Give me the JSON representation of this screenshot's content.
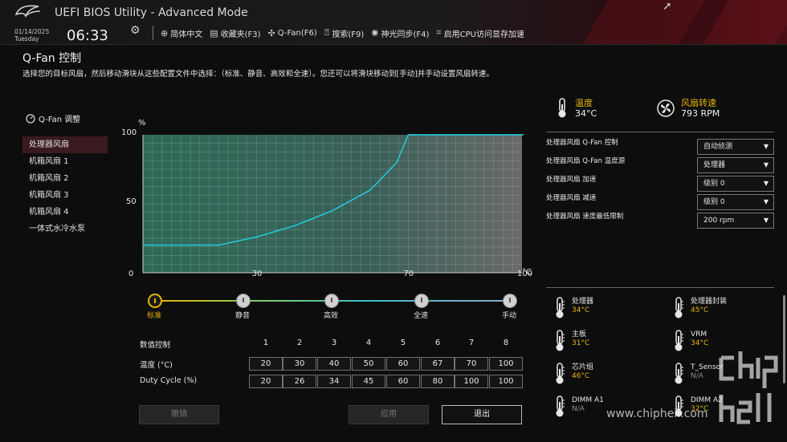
{
  "header": {
    "app_title": "UEFI BIOS Utility - Advanced Mode",
    "date": "01/14/2025",
    "weekday": "Tuesday",
    "time": "06:33",
    "menu": [
      {
        "icon": "globe-icon",
        "label": "简体中文"
      },
      {
        "icon": "bookmark-icon",
        "label": "收藏夹(F3)"
      },
      {
        "icon": "fan-icon",
        "label": "Q-Fan(F6)"
      },
      {
        "icon": "search-icon",
        "label": "搜索(F9)"
      },
      {
        "icon": "aura-icon",
        "label": "神光同步(F4)"
      },
      {
        "icon": "memory-icon",
        "label": "启用CPU访问显存加速"
      }
    ]
  },
  "page": {
    "title": "Q-Fan 控制",
    "description": "选择您的目标风扇，然后移动滑块从这些配置文件中选择：（标准、静音、高效和全速）。您还可以将滑块移动到[手动]并手动设置风扇转速。"
  },
  "fan_panel": {
    "heading": "Q-Fan 调整",
    "fans": [
      "处理器风扇",
      "机箱风扇 1",
      "机箱风扇 2",
      "机箱风扇 3",
      "机箱风扇 4",
      "一体式水冷水泵"
    ],
    "selected_index": 0
  },
  "chart_data": {
    "type": "line",
    "ylabel": "%",
    "xlabel": "°C",
    "xlim": [
      0,
      100
    ],
    "ylim": [
      0,
      100
    ],
    "x_ticks": [
      0,
      30,
      70,
      100
    ],
    "y_ticks": [
      50,
      100
    ],
    "grid": true,
    "series": [
      {
        "x": [
          0,
          20,
          30,
          40,
          50,
          60,
          67,
          70,
          100
        ],
        "y": [
          20,
          20,
          26,
          34,
          45,
          60,
          80,
          100,
          100
        ]
      }
    ],
    "color": "#1fd4e6"
  },
  "presets": {
    "items": [
      "标准",
      "静音",
      "高效",
      "全速",
      "手动"
    ],
    "selected_index": 0
  },
  "table": {
    "header_label": "数值控制",
    "columns": [
      "1",
      "2",
      "3",
      "4",
      "5",
      "6",
      "7",
      "8"
    ],
    "temp_label": "温度 (°C)",
    "temp_values": [
      "20",
      "30",
      "40",
      "50",
      "60",
      "67",
      "70",
      "100"
    ],
    "duty_label": "Duty Cycle (%)",
    "duty_values": [
      "20",
      "26",
      "34",
      "45",
      "60",
      "80",
      "100",
      "100"
    ]
  },
  "buttons": {
    "undo": "撤销",
    "apply": "应用",
    "exit": "退出"
  },
  "metrics": {
    "temp_label": "温度",
    "temp_value": "34°C",
    "fan_label": "风扇转速",
    "fan_value": "793 RPM"
  },
  "settings": [
    {
      "label": "处理器风扇 Q-Fan 控制",
      "value": "自动侦测"
    },
    {
      "label": "处理器风扇 Q-Fan 温度源",
      "value": "处理器"
    },
    {
      "label": "处理器风扇 加速",
      "value": "级别 0"
    },
    {
      "label": "处理器风扇 减速",
      "value": "级别 0"
    },
    {
      "label": "处理器风扇 速度最低限制",
      "value": "200 rpm"
    }
  ],
  "sensors": [
    {
      "name": "处理器",
      "value": "34°C"
    },
    {
      "name": "处理器封装",
      "value": "45°C"
    },
    {
      "name": "主板",
      "value": "31°C"
    },
    {
      "name": "VRM",
      "value": "34°C"
    },
    {
      "name": "芯片组",
      "value": "46°C"
    },
    {
      "name": "T_Sensor",
      "value": "N/A"
    },
    {
      "name": "DIMM A1",
      "value": "N/A"
    },
    {
      "name": "DIMM A2",
      "value": "32°C"
    }
  ],
  "watermark": "www.chiphell.com",
  "colors": {
    "accent": "#e6b400",
    "curve": "#1fd4e6",
    "plot_bg": "#2e5a4f"
  }
}
